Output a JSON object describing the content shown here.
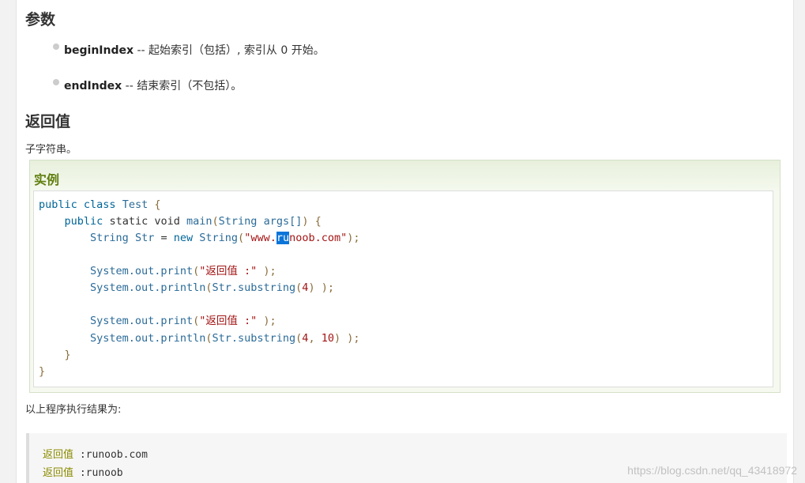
{
  "section_params": {
    "title": "参数",
    "items": [
      {
        "name": "beginIndex",
        "desc": " -- 起始索引（包括）, 索引从 0 开始。"
      },
      {
        "name": "endIndex",
        "desc": " -- 结束索引（不包括）。"
      }
    ]
  },
  "section_return": {
    "title": "返回值",
    "desc": "子字符串。"
  },
  "example": {
    "title": "实例",
    "code": {
      "l1_kw1": "public",
      "l1_kw2": "class",
      "l1_name": "Test",
      "l1_brace": "{",
      "l2_kw1": "public",
      "l2_kw2": "static",
      "l2_kw3": "void",
      "l2_name": "main",
      "l2_paren": "(",
      "l2_type": "String",
      "l2_arg": "args[]",
      "l2_end": ") {",
      "l3_type": "String",
      "l3_var": "Str",
      "l3_eq": " = ",
      "l3_new": "new",
      "l3_type2": "String",
      "l3_open": "(",
      "l3_str_a": "\"www.",
      "l3_str_sel": "ru",
      "l3_str_b": "noob.com\"",
      "l3_close": ");",
      "l5_obj": "System.out.print",
      "l5_open": "(",
      "l5_str": "\"返回值 :\"",
      "l5_close": " );",
      "l6_obj": "System.out.println",
      "l6_open": "(",
      "l6_expr": "Str.substring",
      "l6_open2": "(",
      "l6_num": "4",
      "l6_close": ") );",
      "l8_obj": "System.out.print",
      "l8_open": "(",
      "l8_str": "\"返回值 :\"",
      "l8_close": " );",
      "l9_obj": "System.out.println",
      "l9_open": "(",
      "l9_expr": "Str.substring",
      "l9_open2": "(",
      "l9_num1": "4",
      "l9_comma": ", ",
      "l9_num2": "10",
      "l9_close": ") );",
      "l10_brace": "}",
      "l11_brace": "}"
    }
  },
  "result_intro": "以上程序执行结果为:",
  "results": [
    {
      "key": "返回值",
      "value": " :runoob.com"
    },
    {
      "key": "返回值",
      "value": " :runoob"
    }
  ],
  "watermark": "https://blog.csdn.net/qq_43418972"
}
